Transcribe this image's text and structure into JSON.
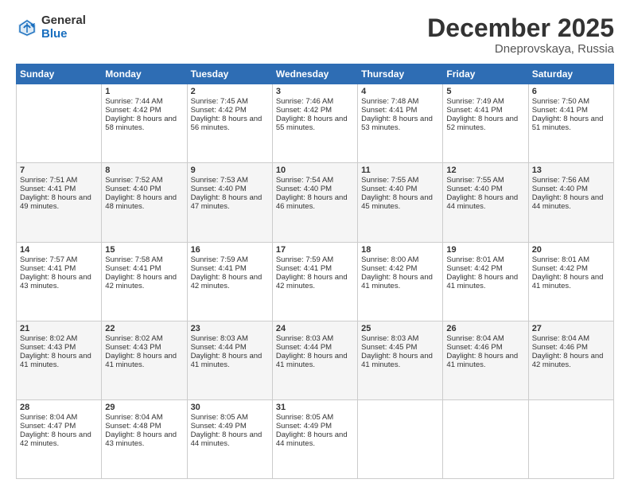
{
  "logo": {
    "general": "General",
    "blue": "Blue"
  },
  "header": {
    "month": "December 2025",
    "location": "Dneprovskaya, Russia"
  },
  "weekdays": [
    "Sunday",
    "Monday",
    "Tuesday",
    "Wednesday",
    "Thursday",
    "Friday",
    "Saturday"
  ],
  "weeks": [
    [
      {
        "day": "",
        "sunrise": "",
        "sunset": "",
        "daylight": ""
      },
      {
        "day": "1",
        "sunrise": "Sunrise: 7:44 AM",
        "sunset": "Sunset: 4:42 PM",
        "daylight": "Daylight: 8 hours and 58 minutes."
      },
      {
        "day": "2",
        "sunrise": "Sunrise: 7:45 AM",
        "sunset": "Sunset: 4:42 PM",
        "daylight": "Daylight: 8 hours and 56 minutes."
      },
      {
        "day": "3",
        "sunrise": "Sunrise: 7:46 AM",
        "sunset": "Sunset: 4:42 PM",
        "daylight": "Daylight: 8 hours and 55 minutes."
      },
      {
        "day": "4",
        "sunrise": "Sunrise: 7:48 AM",
        "sunset": "Sunset: 4:41 PM",
        "daylight": "Daylight: 8 hours and 53 minutes."
      },
      {
        "day": "5",
        "sunrise": "Sunrise: 7:49 AM",
        "sunset": "Sunset: 4:41 PM",
        "daylight": "Daylight: 8 hours and 52 minutes."
      },
      {
        "day": "6",
        "sunrise": "Sunrise: 7:50 AM",
        "sunset": "Sunset: 4:41 PM",
        "daylight": "Daylight: 8 hours and 51 minutes."
      }
    ],
    [
      {
        "day": "7",
        "sunrise": "Sunrise: 7:51 AM",
        "sunset": "Sunset: 4:41 PM",
        "daylight": "Daylight: 8 hours and 49 minutes."
      },
      {
        "day": "8",
        "sunrise": "Sunrise: 7:52 AM",
        "sunset": "Sunset: 4:40 PM",
        "daylight": "Daylight: 8 hours and 48 minutes."
      },
      {
        "day": "9",
        "sunrise": "Sunrise: 7:53 AM",
        "sunset": "Sunset: 4:40 PM",
        "daylight": "Daylight: 8 hours and 47 minutes."
      },
      {
        "day": "10",
        "sunrise": "Sunrise: 7:54 AM",
        "sunset": "Sunset: 4:40 PM",
        "daylight": "Daylight: 8 hours and 46 minutes."
      },
      {
        "day": "11",
        "sunrise": "Sunrise: 7:55 AM",
        "sunset": "Sunset: 4:40 PM",
        "daylight": "Daylight: 8 hours and 45 minutes."
      },
      {
        "day": "12",
        "sunrise": "Sunrise: 7:55 AM",
        "sunset": "Sunset: 4:40 PM",
        "daylight": "Daylight: 8 hours and 44 minutes."
      },
      {
        "day": "13",
        "sunrise": "Sunrise: 7:56 AM",
        "sunset": "Sunset: 4:40 PM",
        "daylight": "Daylight: 8 hours and 44 minutes."
      }
    ],
    [
      {
        "day": "14",
        "sunrise": "Sunrise: 7:57 AM",
        "sunset": "Sunset: 4:41 PM",
        "daylight": "Daylight: 8 hours and 43 minutes."
      },
      {
        "day": "15",
        "sunrise": "Sunrise: 7:58 AM",
        "sunset": "Sunset: 4:41 PM",
        "daylight": "Daylight: 8 hours and 42 minutes."
      },
      {
        "day": "16",
        "sunrise": "Sunrise: 7:59 AM",
        "sunset": "Sunset: 4:41 PM",
        "daylight": "Daylight: 8 hours and 42 minutes."
      },
      {
        "day": "17",
        "sunrise": "Sunrise: 7:59 AM",
        "sunset": "Sunset: 4:41 PM",
        "daylight": "Daylight: 8 hours and 42 minutes."
      },
      {
        "day": "18",
        "sunrise": "Sunrise: 8:00 AM",
        "sunset": "Sunset: 4:42 PM",
        "daylight": "Daylight: 8 hours and 41 minutes."
      },
      {
        "day": "19",
        "sunrise": "Sunrise: 8:01 AM",
        "sunset": "Sunset: 4:42 PM",
        "daylight": "Daylight: 8 hours and 41 minutes."
      },
      {
        "day": "20",
        "sunrise": "Sunrise: 8:01 AM",
        "sunset": "Sunset: 4:42 PM",
        "daylight": "Daylight: 8 hours and 41 minutes."
      }
    ],
    [
      {
        "day": "21",
        "sunrise": "Sunrise: 8:02 AM",
        "sunset": "Sunset: 4:43 PM",
        "daylight": "Daylight: 8 hours and 41 minutes."
      },
      {
        "day": "22",
        "sunrise": "Sunrise: 8:02 AM",
        "sunset": "Sunset: 4:43 PM",
        "daylight": "Daylight: 8 hours and 41 minutes."
      },
      {
        "day": "23",
        "sunrise": "Sunrise: 8:03 AM",
        "sunset": "Sunset: 4:44 PM",
        "daylight": "Daylight: 8 hours and 41 minutes."
      },
      {
        "day": "24",
        "sunrise": "Sunrise: 8:03 AM",
        "sunset": "Sunset: 4:44 PM",
        "daylight": "Daylight: 8 hours and 41 minutes."
      },
      {
        "day": "25",
        "sunrise": "Sunrise: 8:03 AM",
        "sunset": "Sunset: 4:45 PM",
        "daylight": "Daylight: 8 hours and 41 minutes."
      },
      {
        "day": "26",
        "sunrise": "Sunrise: 8:04 AM",
        "sunset": "Sunset: 4:46 PM",
        "daylight": "Daylight: 8 hours and 41 minutes."
      },
      {
        "day": "27",
        "sunrise": "Sunrise: 8:04 AM",
        "sunset": "Sunset: 4:46 PM",
        "daylight": "Daylight: 8 hours and 42 minutes."
      }
    ],
    [
      {
        "day": "28",
        "sunrise": "Sunrise: 8:04 AM",
        "sunset": "Sunset: 4:47 PM",
        "daylight": "Daylight: 8 hours and 42 minutes."
      },
      {
        "day": "29",
        "sunrise": "Sunrise: 8:04 AM",
        "sunset": "Sunset: 4:48 PM",
        "daylight": "Daylight: 8 hours and 43 minutes."
      },
      {
        "day": "30",
        "sunrise": "Sunrise: 8:05 AM",
        "sunset": "Sunset: 4:49 PM",
        "daylight": "Daylight: 8 hours and 44 minutes."
      },
      {
        "day": "31",
        "sunrise": "Sunrise: 8:05 AM",
        "sunset": "Sunset: 4:49 PM",
        "daylight": "Daylight: 8 hours and 44 minutes."
      },
      {
        "day": "",
        "sunrise": "",
        "sunset": "",
        "daylight": ""
      },
      {
        "day": "",
        "sunrise": "",
        "sunset": "",
        "daylight": ""
      },
      {
        "day": "",
        "sunrise": "",
        "sunset": "",
        "daylight": ""
      }
    ]
  ]
}
